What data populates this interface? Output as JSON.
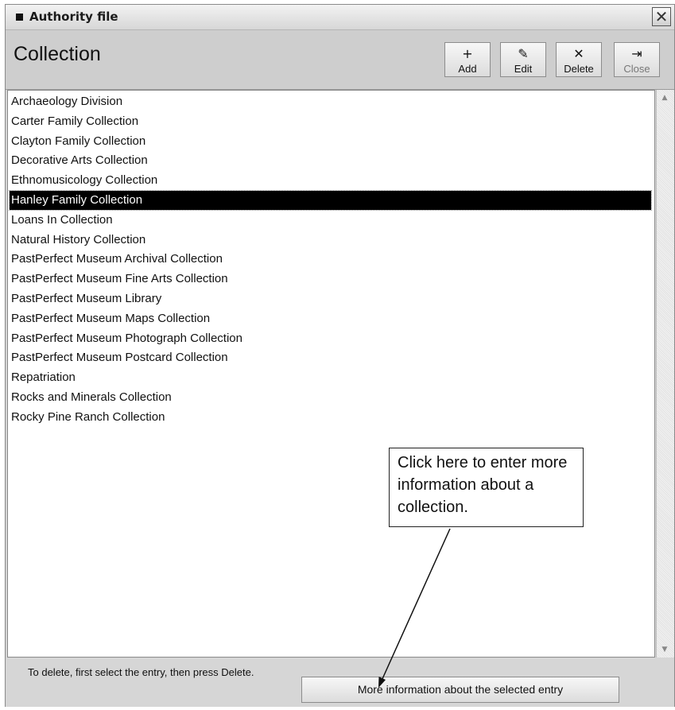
{
  "window": {
    "title": "Authority file",
    "close_glyph": "✕"
  },
  "header": {
    "title": "Collection"
  },
  "toolbar": [
    {
      "label": "Add",
      "icon": "+",
      "icon_name": "add-icon",
      "enabled": true
    },
    {
      "label": "Edit",
      "icon": "✎",
      "icon_name": "edit-icon",
      "enabled": true
    },
    {
      "label": "Delete",
      "icon": "✕",
      "icon_name": "delete-icon",
      "enabled": true
    },
    {
      "label": "Close",
      "icon": "⇥",
      "icon_name": "close-door-icon",
      "enabled": false
    }
  ],
  "list": {
    "selected_index": 5,
    "items": [
      "Archaeology Division",
      "Carter Family Collection",
      "Clayton Family Collection",
      "Decorative Arts Collection",
      "Ethnomusicology Collection",
      "Hanley Family Collection",
      "Loans In Collection",
      "Natural History Collection",
      "PastPerfect Museum Archival Collection",
      "PastPerfect Museum Fine Arts Collection",
      "PastPerfect Museum Library",
      "PastPerfect Museum Maps Collection",
      "PastPerfect Museum Photograph Collection",
      "PastPerfect Museum Postcard Collection",
      "Repatriation",
      "Rocks and Minerals Collection",
      "Rocky Pine Ranch Collection"
    ]
  },
  "footer": {
    "hint": "To delete, first select the entry, then press Delete.",
    "more_button": "More information about the selected entry"
  },
  "callout": {
    "text": "Click here to enter more information about a collection."
  },
  "colors": {
    "selection_bg": "#000000",
    "window_bg": "#d6d6d6"
  }
}
